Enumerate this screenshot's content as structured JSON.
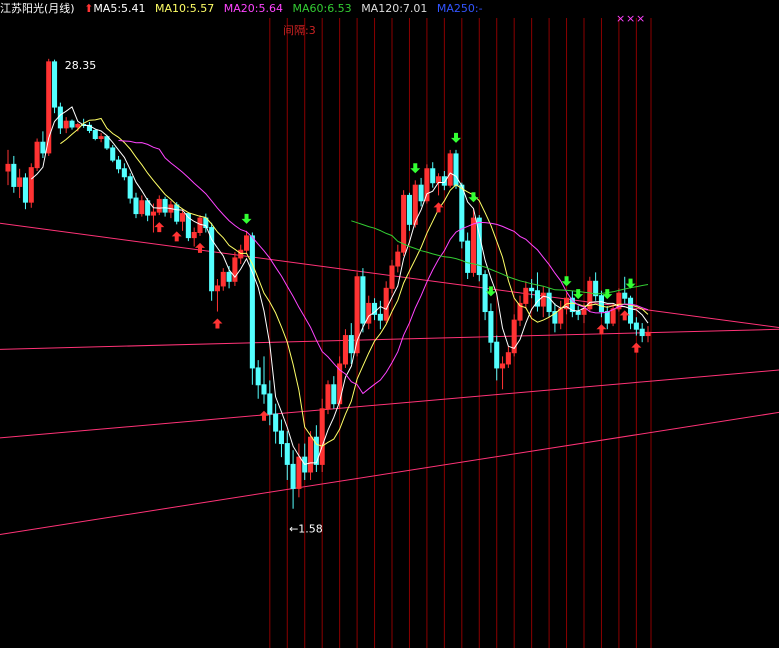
{
  "header": {
    "title": "江苏阳光(月线)",
    "ma_items": [
      {
        "label": "MA5:5.41",
        "color": "#ffffff"
      },
      {
        "label": "MA10:5.57",
        "color": "#ffff66"
      },
      {
        "label": "MA20:5.64",
        "color": "#ff44ff"
      },
      {
        "label": "MA60:6.53",
        "color": "#33cc33"
      },
      {
        "label": "MA120:7.01",
        "color": "#dddddd"
      },
      {
        "label": "MA250:-",
        "color": "#3355ff"
      }
    ],
    "period_label": "间隔:3"
  },
  "colors": {
    "background": "#000000",
    "up_candle": "#ff3333",
    "down_candle": "#54ffff",
    "ma5": "#ffffff",
    "ma10": "#ffff66",
    "ma20": "#ff44ff",
    "ma60": "#33cc33",
    "ma120": "#dddddd",
    "channel": "#ff3377",
    "vgrid": "#8b0000",
    "buy_arrow": "#ff3333",
    "sell_arrow": "#33ff33"
  },
  "chart_data": {
    "type": "candlestick",
    "title": "江苏阳光(月线)",
    "ylim": [
      1.0,
      30.0
    ],
    "ohlc": [
      [
        13.8,
        15.8,
        12.6,
        14.4
      ],
      [
        14.4,
        15.2,
        12.0,
        12.5
      ],
      [
        12.5,
        14.0,
        11.6,
        13.2
      ],
      [
        13.2,
        13.6,
        10.8,
        11.3
      ],
      [
        11.3,
        14.5,
        10.9,
        14.1
      ],
      [
        14.1,
        17.0,
        13.8,
        16.6
      ],
      [
        16.6,
        17.8,
        15.0,
        15.5
      ],
      [
        15.5,
        28.35,
        15.2,
        27.8
      ],
      [
        27.8,
        28.2,
        20.0,
        20.8
      ],
      [
        20.8,
        21.4,
        17.5,
        18.2
      ],
      [
        18.2,
        19.5,
        17.6,
        19.0
      ],
      [
        19.0,
        19.2,
        18.0,
        18.3
      ],
      [
        18.3,
        18.8,
        17.8,
        18.6
      ],
      [
        18.6,
        19.3,
        18.2,
        18.5
      ],
      [
        18.5,
        18.9,
        17.6,
        17.9
      ],
      [
        17.9,
        18.1,
        16.8,
        17.0
      ],
      [
        17.0,
        17.6,
        16.6,
        17.2
      ],
      [
        17.2,
        17.4,
        15.8,
        16.0
      ],
      [
        16.0,
        16.3,
        14.6,
        14.8
      ],
      [
        14.8,
        15.2,
        13.6,
        14.0
      ],
      [
        14.0,
        14.5,
        13.0,
        13.3
      ],
      [
        13.3,
        13.6,
        11.2,
        11.6
      ],
      [
        11.6,
        12.0,
        10.2,
        10.5
      ],
      [
        10.5,
        11.8,
        10.3,
        11.4
      ],
      [
        11.4,
        11.6,
        10.0,
        10.4
      ],
      [
        10.4,
        11.2,
        9.3,
        10.6
      ],
      [
        10.6,
        11.8,
        10.4,
        11.5
      ],
      [
        11.5,
        11.7,
        10.3,
        10.6
      ],
      [
        10.6,
        11.4,
        10.2,
        11.1
      ],
      [
        11.1,
        11.3,
        9.8,
        10.0
      ],
      [
        10.0,
        10.8,
        9.4,
        10.5
      ],
      [
        10.5,
        10.6,
        8.8,
        9.0
      ],
      [
        9.0,
        9.6,
        8.5,
        9.3
      ],
      [
        9.3,
        10.4,
        9.1,
        10.2
      ],
      [
        10.2,
        10.5,
        9.3,
        9.6
      ],
      [
        9.6,
        9.9,
        6.0,
        6.4
      ],
      [
        6.4,
        6.9,
        5.6,
        6.6
      ],
      [
        6.6,
        7.4,
        6.4,
        7.2
      ],
      [
        7.2,
        7.5,
        6.5,
        6.8
      ],
      [
        6.8,
        8.2,
        6.6,
        7.9
      ],
      [
        7.9,
        8.6,
        7.6,
        8.3
      ],
      [
        8.3,
        9.4,
        8.1,
        9.1
      ],
      [
        9.1,
        9.3,
        3.5,
        3.9
      ],
      [
        3.9,
        4.1,
        3.2,
        3.5
      ],
      [
        3.5,
        4.2,
        3.1,
        3.3
      ],
      [
        3.3,
        3.6,
        2.7,
        2.9
      ],
      [
        2.9,
        3.1,
        2.4,
        2.6
      ],
      [
        2.6,
        2.8,
        2.2,
        2.4
      ],
      [
        2.4,
        2.6,
        1.9,
        2.1
      ],
      [
        2.1,
        2.3,
        1.58,
        1.8
      ],
      [
        1.8,
        2.4,
        1.7,
        2.2
      ],
      [
        2.2,
        2.4,
        1.9,
        2.0
      ],
      [
        2.0,
        2.6,
        1.9,
        2.5
      ],
      [
        2.5,
        2.7,
        2.0,
        2.1
      ],
      [
        2.1,
        3.2,
        2.0,
        3.0
      ],
      [
        3.0,
        3.6,
        2.9,
        3.5
      ],
      [
        3.5,
        3.7,
        3.0,
        3.1
      ],
      [
        3.1,
        4.2,
        3.0,
        4.0
      ],
      [
        4.0,
        5.0,
        3.9,
        4.8
      ],
      [
        4.8,
        5.2,
        4.0,
        4.3
      ],
      [
        4.3,
        7.2,
        4.2,
        7.0
      ],
      [
        7.0,
        7.4,
        4.9,
        5.2
      ],
      [
        5.2,
        6.2,
        5.0,
        5.9
      ],
      [
        5.9,
        6.1,
        5.3,
        5.5
      ],
      [
        5.5,
        6.0,
        5.0,
        5.3
      ],
      [
        5.3,
        6.8,
        5.2,
        6.5
      ],
      [
        6.5,
        7.8,
        6.3,
        7.5
      ],
      [
        7.5,
        8.6,
        7.2,
        8.2
      ],
      [
        8.2,
        12.2,
        8.0,
        11.8
      ],
      [
        11.8,
        12.0,
        9.4,
        9.8
      ],
      [
        9.8,
        13.0,
        9.6,
        12.6
      ],
      [
        12.6,
        13.2,
        11.0,
        11.4
      ],
      [
        11.4,
        14.4,
        11.2,
        14.0
      ],
      [
        14.0,
        14.6,
        12.4,
        12.8
      ],
      [
        12.8,
        13.6,
        11.8,
        13.3
      ],
      [
        13.3,
        13.8,
        12.2,
        12.6
      ],
      [
        12.6,
        15.8,
        12.4,
        15.4
      ],
      [
        15.4,
        15.8,
        12.3,
        12.6
      ],
      [
        12.6,
        12.8,
        8.4,
        8.8
      ],
      [
        8.8,
        9.3,
        6.9,
        7.2
      ],
      [
        7.2,
        10.8,
        7.0,
        10.2
      ],
      [
        10.2,
        10.4,
        6.8,
        7.1
      ],
      [
        7.1,
        7.3,
        5.3,
        5.6
      ],
      [
        5.6,
        5.9,
        4.3,
        4.6
      ],
      [
        4.6,
        4.8,
        3.6,
        3.9
      ],
      [
        3.9,
        4.2,
        3.4,
        4.0
      ],
      [
        4.0,
        4.5,
        3.9,
        4.3
      ],
      [
        4.3,
        5.5,
        4.2,
        5.3
      ],
      [
        5.3,
        6.2,
        5.1,
        5.9
      ],
      [
        5.9,
        6.8,
        5.7,
        6.5
      ],
      [
        6.5,
        6.9,
        6.1,
        6.4
      ],
      [
        6.4,
        7.2,
        5.6,
        5.8
      ],
      [
        5.8,
        6.6,
        5.4,
        6.3
      ],
      [
        6.3,
        6.5,
        5.4,
        5.6
      ],
      [
        5.6,
        5.9,
        4.9,
        5.2
      ],
      [
        5.2,
        6.0,
        5.0,
        5.7
      ],
      [
        5.7,
        6.3,
        5.5,
        6.1
      ],
      [
        6.1,
        6.4,
        5.4,
        5.6
      ],
      [
        5.6,
        5.8,
        5.3,
        5.5
      ],
      [
        5.5,
        5.9,
        5.2,
        5.7
      ],
      [
        5.7,
        7.0,
        5.6,
        6.8
      ],
      [
        6.8,
        7.2,
        6.0,
        6.2
      ],
      [
        6.2,
        6.4,
        5.4,
        5.6
      ],
      [
        5.6,
        5.8,
        5.0,
        5.2
      ],
      [
        5.2,
        5.9,
        5.1,
        5.7
      ],
      [
        5.7,
        6.5,
        5.6,
        6.3
      ],
      [
        6.3,
        7.0,
        5.9,
        6.1
      ],
      [
        6.1,
        6.2,
        5.0,
        5.2
      ],
      [
        5.2,
        5.4,
        4.8,
        5.0
      ],
      [
        5.0,
        5.2,
        4.6,
        4.8
      ],
      [
        4.8,
        5.1,
        4.6,
        4.9
      ]
    ],
    "annotations": [
      {
        "text": "28.35",
        "type": "high",
        "index": 7,
        "value": 28.35
      },
      {
        "text": "←1.58",
        "type": "low",
        "index": 49,
        "value": 1.58
      }
    ],
    "buy_signals": [
      26,
      29,
      33,
      36,
      44,
      74,
      102,
      106,
      108
    ],
    "sell_signals": [
      41,
      70,
      77,
      80,
      83,
      96,
      98,
      103,
      107
    ],
    "channel_lines": [
      {
        "from": [
          0,
          9.8
        ],
        "to": [
          112,
          5.6
        ]
      },
      {
        "from": [
          0,
          4.4
        ],
        "to": [
          112,
          4.9
        ]
      },
      {
        "from": [
          0,
          2.5
        ],
        "to": [
          112,
          3.6
        ]
      },
      {
        "from": [
          0,
          1.35
        ],
        "to": [
          112,
          2.6
        ]
      }
    ]
  }
}
